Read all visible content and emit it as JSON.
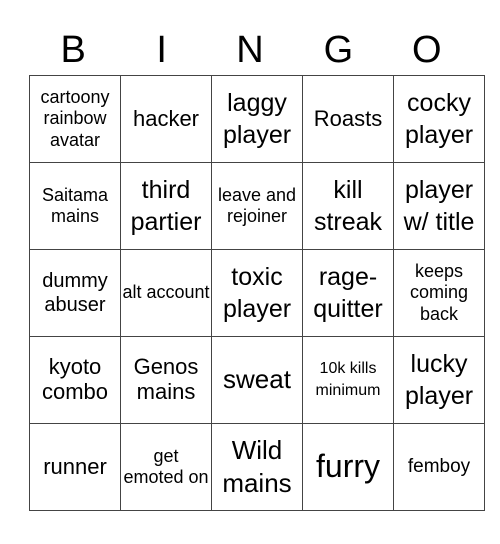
{
  "header": {
    "letters": [
      "B",
      "I",
      "N",
      "G",
      "O"
    ]
  },
  "grid": [
    [
      "cartoony rainbow avatar",
      "hacker",
      "laggy player",
      "Roasts",
      "cocky player"
    ],
    [
      "Saitama mains",
      "third partier",
      "leave and rejoiner",
      "kill streak",
      "player w/ title"
    ],
    [
      "dummy abuser",
      "alt account",
      "toxic player",
      "rage-quitter",
      "keeps coming back"
    ],
    [
      "kyoto combo",
      "Genos mains",
      "sweat",
      "10k kills minimum",
      "lucky player"
    ],
    [
      "runner",
      "get emoted on",
      "Wild mains",
      "furry",
      "femboy"
    ]
  ]
}
